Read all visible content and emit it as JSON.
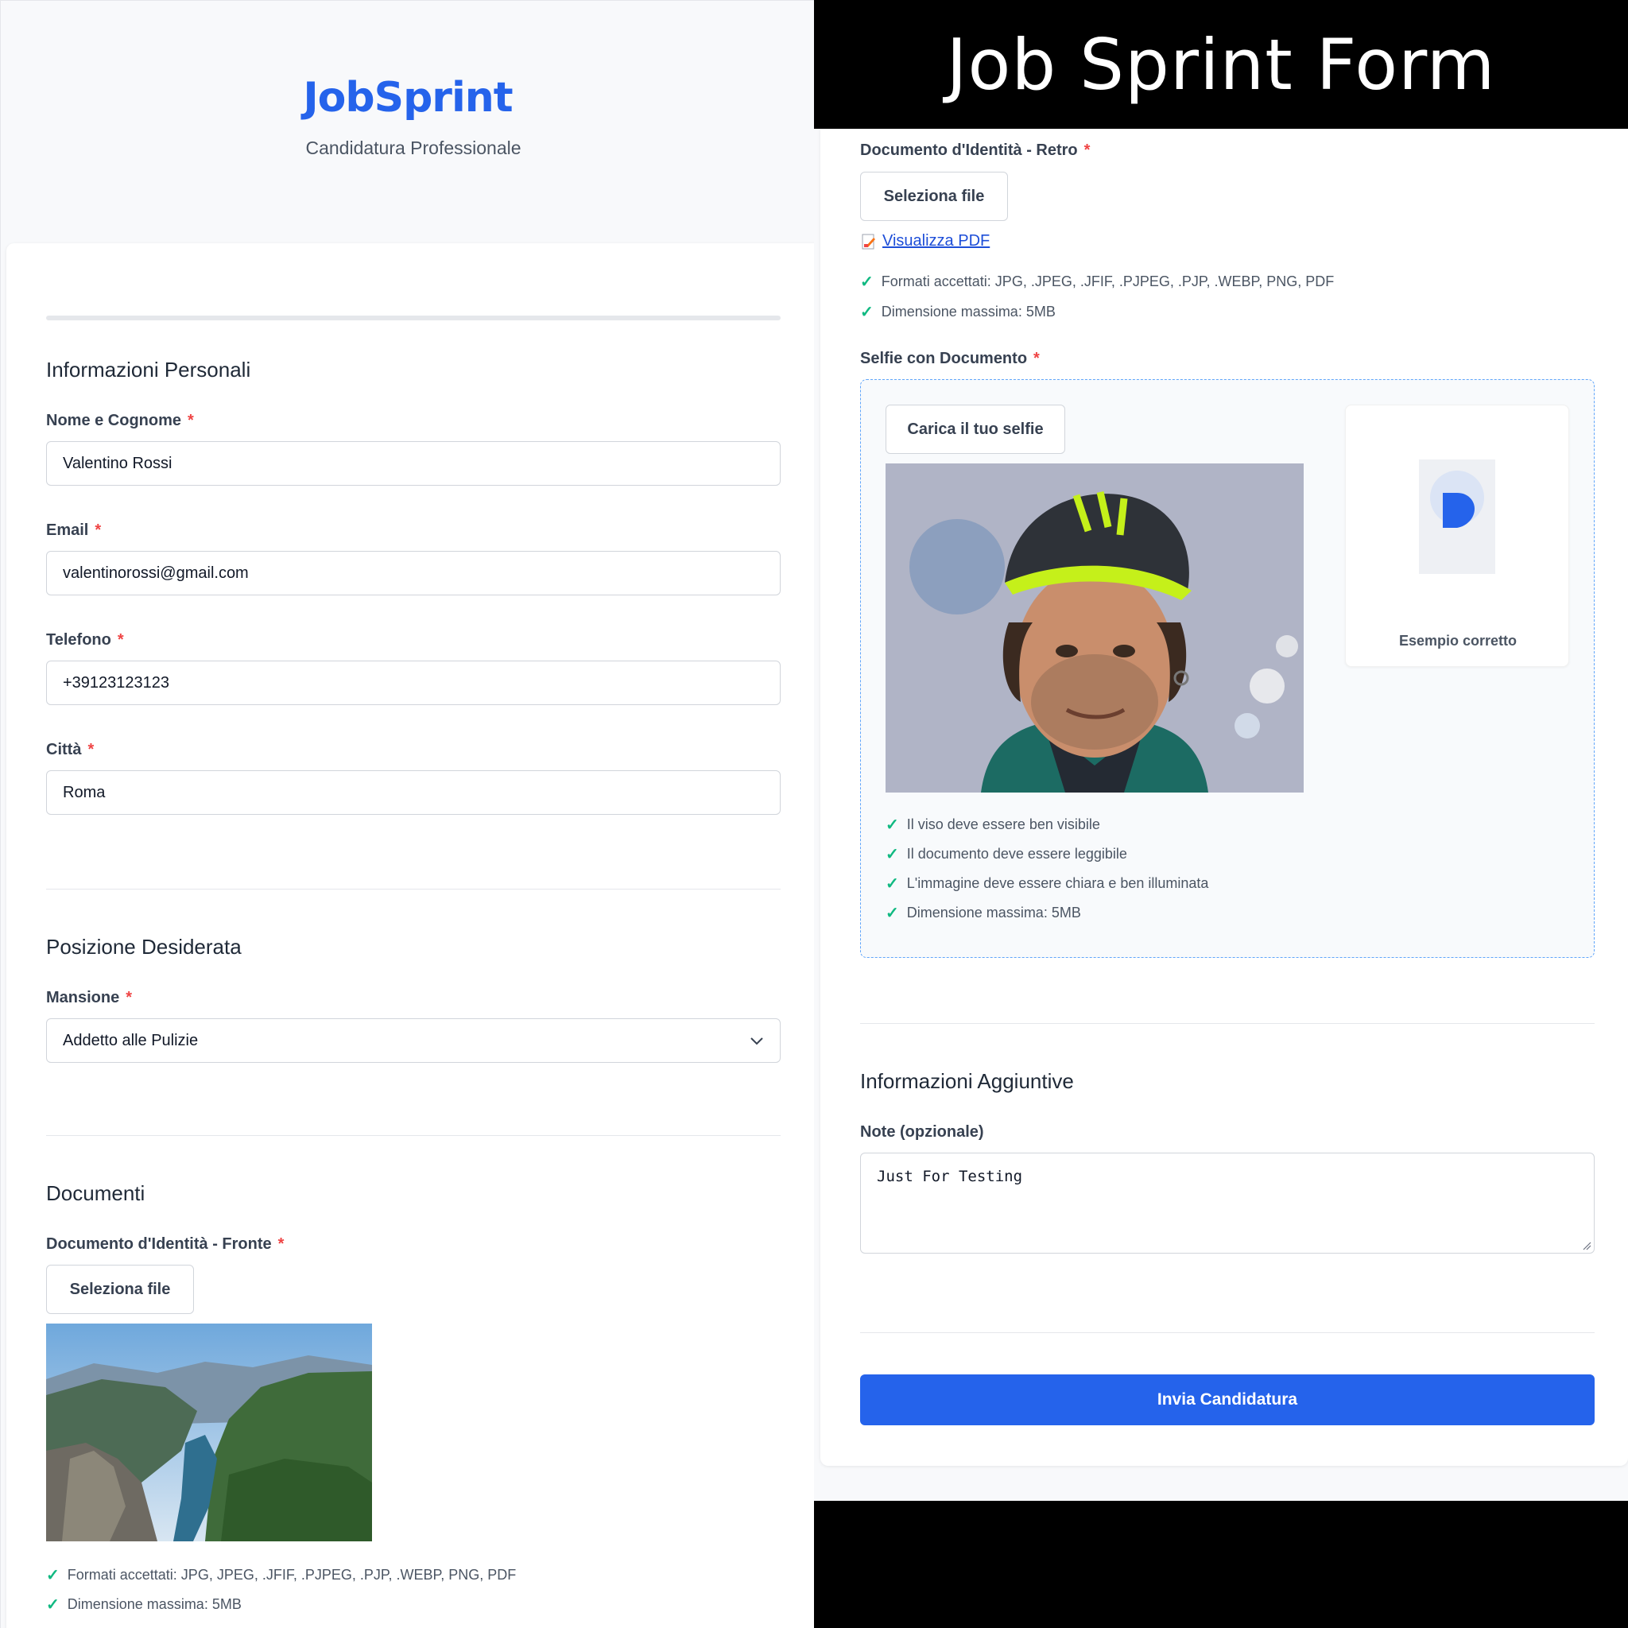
{
  "app": {
    "brand": "JobSprint",
    "tagline": "Candidatura Professionale",
    "banner_title": "Job Sprint Form"
  },
  "personal": {
    "title": "Informazioni Personali",
    "name_label": "Nome e Cognome",
    "name_value": "Valentino Rossi",
    "email_label": "Email",
    "email_value": "valentinorossi@gmail.com",
    "phone_label": "Telefono",
    "phone_value": "+39123123123",
    "city_label": "Città",
    "city_value": "Roma",
    "required_mark": "*"
  },
  "position": {
    "title": "Posizione Desiderata",
    "role_label": "Mansione",
    "role_value": "Addetto alle Pulizie"
  },
  "documents": {
    "title": "Documenti",
    "front_label": "Documento d'Identità - Fronte",
    "front_button": "Seleziona file",
    "front_hints": [
      "Formati accettati: JPG, JPEG, .JFIF, .PJPEG, .PJP, .WEBP, PNG, PDF",
      "Dimensione massima: 5MB"
    ],
    "back_label": "Documento d'Identità - Retro",
    "back_button": "Seleziona file",
    "back_link": "Visualizza PDF",
    "back_hints": [
      "Formati accettati: JPG, .JPEG, .JFIF, .PJPEG, .PJP, .WEBP, PNG, PDF",
      "Dimensione massima: 5MB"
    ],
    "selfie_label": "Selfie con Documento",
    "selfie_button": "Carica il tuo selfie",
    "example_label": "Esempio corretto",
    "selfie_hints": [
      "Il viso deve essere ben visibile",
      "Il documento deve essere leggibile",
      "L'immagine deve essere chiara e ben illuminata",
      "Dimensione massima: 5MB"
    ]
  },
  "additional": {
    "title": "Informazioni Aggiuntive",
    "notes_label": "Note (opzionale)",
    "notes_value": "Just For Testing"
  },
  "submit_label": "Invia Candidatura",
  "colors": {
    "accent": "#2563eb",
    "required": "#ef4444",
    "check": "#10b981"
  },
  "icons": {
    "check": "check-icon",
    "chevron": "chevron-down-icon",
    "pdf": "pdf-file-icon"
  }
}
